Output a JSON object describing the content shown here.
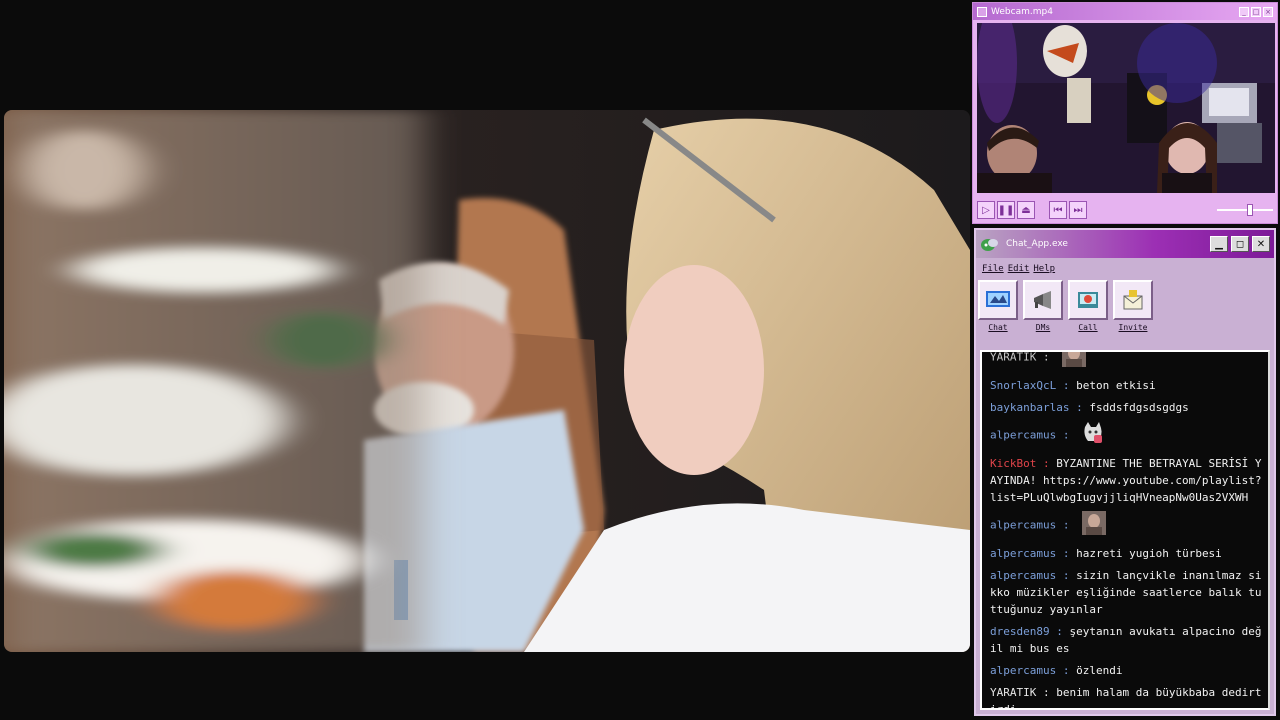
{
  "webcam": {
    "title": "Webcam.mp4",
    "controls": [
      "play",
      "pause",
      "eject",
      "previous",
      "next"
    ],
    "volume_level": 0.6
  },
  "chat": {
    "title": "Chat_App.exe",
    "menu": [
      "File",
      "Edit",
      "Help"
    ],
    "toolbar": [
      {
        "label": "Chat",
        "icon": "chat-icon"
      },
      {
        "label": "DMs",
        "icon": "megaphone-icon"
      },
      {
        "label": "Call",
        "icon": "call-icon"
      },
      {
        "label": "Invite",
        "icon": "invite-icon"
      }
    ],
    "messages": [
      {
        "user": "YARATIK",
        "text": "",
        "user_color": "#c8c8c8",
        "emote": "photo-emote"
      },
      {
        "user": "SnorlaxQcL",
        "text": "beton etkisi",
        "user_color": "#7c9fd9"
      },
      {
        "user": "baykanbarlas",
        "text": "fsddsfdgsdsgdgs",
        "user_color": "#7c9fd9"
      },
      {
        "user": "alpercamus",
        "text": "",
        "user_color": "#7c9fd9",
        "emote": "cat-emote"
      },
      {
        "user": "KickBot",
        "text": "BYZANTINE THE BETRAYAL SERİSİ YAYINDA! https://www.youtube.com/playlist?list=PLuQlwbgIugvjjliqHVneapNw0Uas2VXWH",
        "user_color": "#e0444a"
      },
      {
        "user": "alpercamus",
        "text": "",
        "user_color": "#7c9fd9",
        "emote": "photo-emote"
      },
      {
        "user": "alpercamus",
        "text": "hazreti yugioh türbesi",
        "user_color": "#7c9fd9"
      },
      {
        "user": "alpercamus",
        "text": "sizin lançvikle inanılmaz sikko müzikler eşliğinde saatlerce balık tuttuğunuz yayınlar",
        "user_color": "#7c9fd9"
      },
      {
        "user": "dresden89",
        "text": "şeytanın avukatı alpacino değil mi bus es",
        "user_color": "#7c9fd9"
      },
      {
        "user": "alpercamus",
        "text": "özlendi",
        "user_color": "#7c9fd9"
      },
      {
        "user": "YARATIK",
        "text": "benim halam da büyükbaba dedirtirdi",
        "user_color": "#e6e6e6"
      }
    ]
  }
}
